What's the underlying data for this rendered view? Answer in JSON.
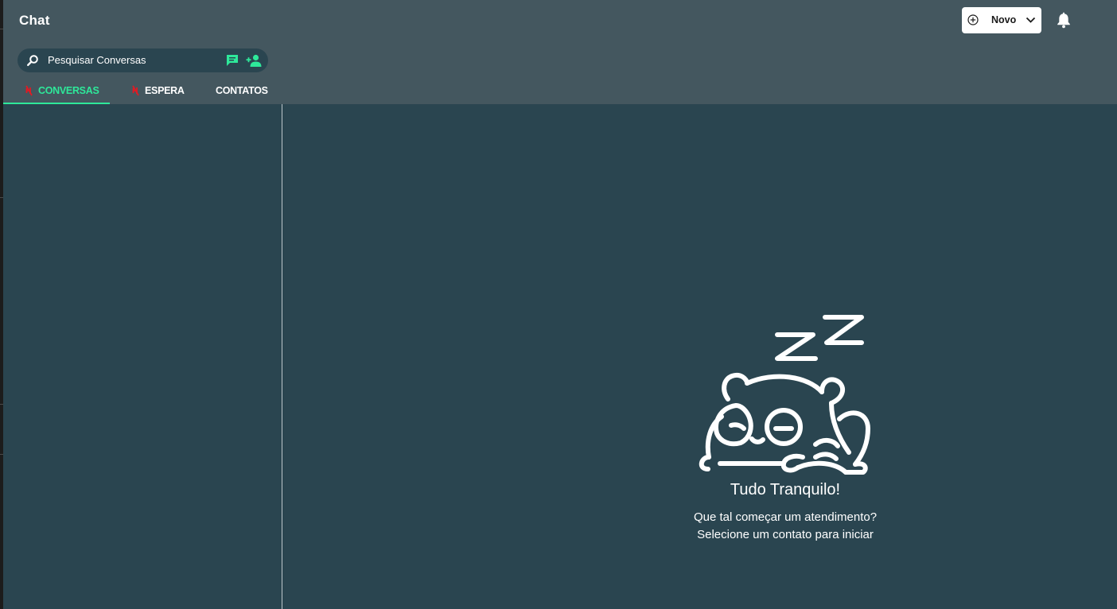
{
  "header": {
    "title": "Chat",
    "new_button_label": "Novo"
  },
  "search": {
    "placeholder": "Pesquisar Conversas",
    "icons": [
      "search-icon",
      "chat-icon",
      "add-person-icon"
    ]
  },
  "tabs": [
    {
      "label": "CONVERSAS",
      "active": true,
      "icon": "muted-icon"
    },
    {
      "label": "ESPERA",
      "active": false,
      "icon": "muted-icon"
    },
    {
      "label": "CONTATOS",
      "active": false
    }
  ],
  "empty_state": {
    "title": "Tudo Tranquilo!",
    "line1": "Que tal começar um atendimento?",
    "line2": "Selecione um contato para iniciar",
    "illustration": "sleeping-panda"
  },
  "colors": {
    "header_bg": "#44575f",
    "body_bg": "#2a4550",
    "accent": "#2ee89a",
    "muted_icon": "#e01b24"
  }
}
